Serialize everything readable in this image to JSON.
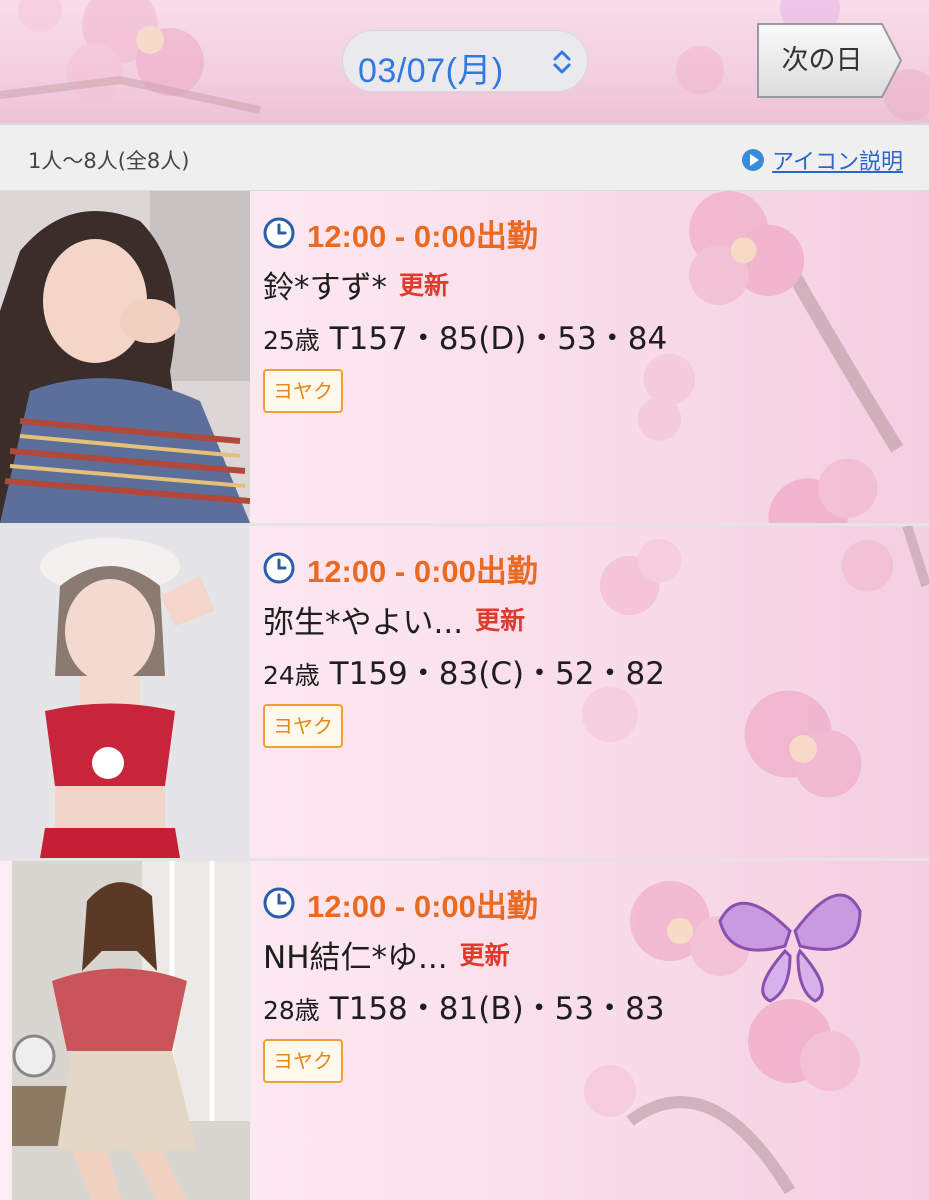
{
  "header": {
    "date_label": "03/07(月)",
    "next_day_label": "次の日"
  },
  "summary": {
    "count_label": "1人〜8人(全8人)",
    "icon_help_label": "アイコン説明"
  },
  "colors": {
    "time": "#ea6a22",
    "update_badge": "#e03a2a",
    "date_text": "#2f79e0",
    "link": "#2a67c8",
    "reserve_border": "#f0a030"
  },
  "staff": [
    {
      "time": "12:00 - 0:00出勤",
      "name": "鈴*すず*",
      "badge": "更新",
      "age": "25歳",
      "measurements": "T157・85(D)・53・84",
      "reserve_label": "ヨヤク"
    },
    {
      "time": "12:00 - 0:00出勤",
      "name": "弥生*やよい...",
      "badge": "更新",
      "age": "24歳",
      "measurements": "T159・83(C)・52・82",
      "reserve_label": "ヨヤク"
    },
    {
      "time": "12:00 - 0:00出勤",
      "name": "NH結仁*ゆ...",
      "badge": "更新",
      "age": "28歳",
      "measurements": "T158・81(B)・53・83",
      "reserve_label": "ヨヤク"
    }
  ]
}
